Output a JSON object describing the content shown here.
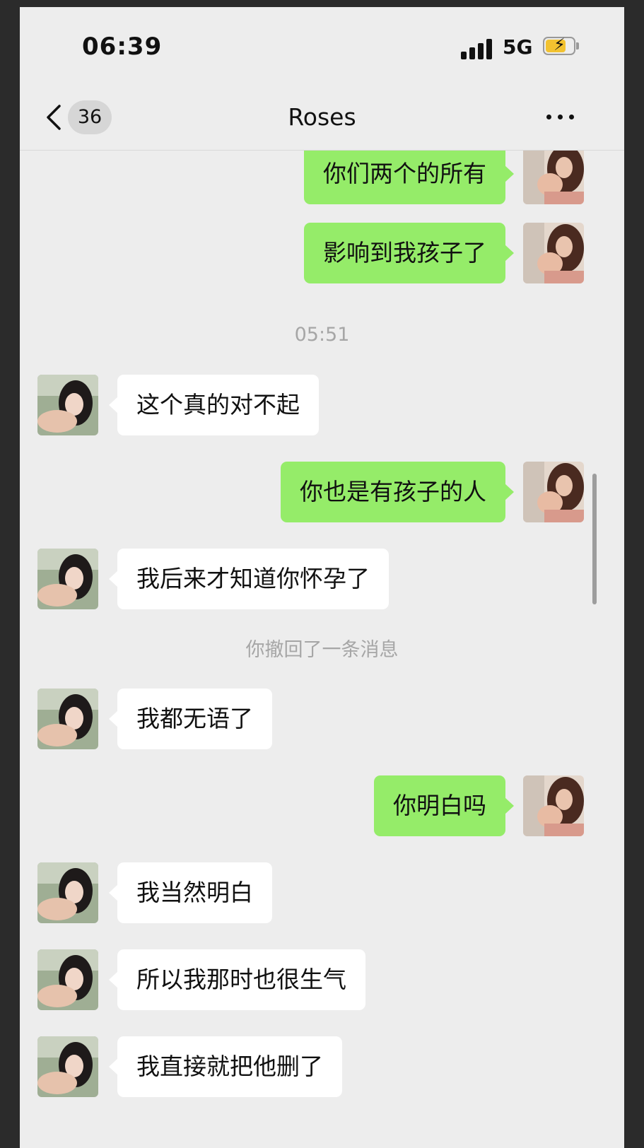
{
  "status_bar": {
    "time": "06:39",
    "network": "5G"
  },
  "nav": {
    "unread_count": "36",
    "title": "Roses"
  },
  "messages": [
    {
      "side": "right",
      "text": "你们两个的所有"
    },
    {
      "side": "right",
      "text": "影响到我孩子了"
    },
    {
      "type": "time",
      "text": "05:51"
    },
    {
      "side": "left",
      "text": "这个真的对不起"
    },
    {
      "side": "right",
      "text": "你也是有孩子的人"
    },
    {
      "side": "left",
      "text": "我后来才知道你怀孕了"
    },
    {
      "type": "system",
      "text": "你撤回了一条消息"
    },
    {
      "side": "left",
      "text": "我都无语了"
    },
    {
      "side": "right",
      "text": "你明白吗"
    },
    {
      "side": "left",
      "text": "我当然明白"
    },
    {
      "side": "left",
      "text": "所以我那时也很生气"
    },
    {
      "side": "left",
      "text": "我直接就把他删了"
    }
  ]
}
